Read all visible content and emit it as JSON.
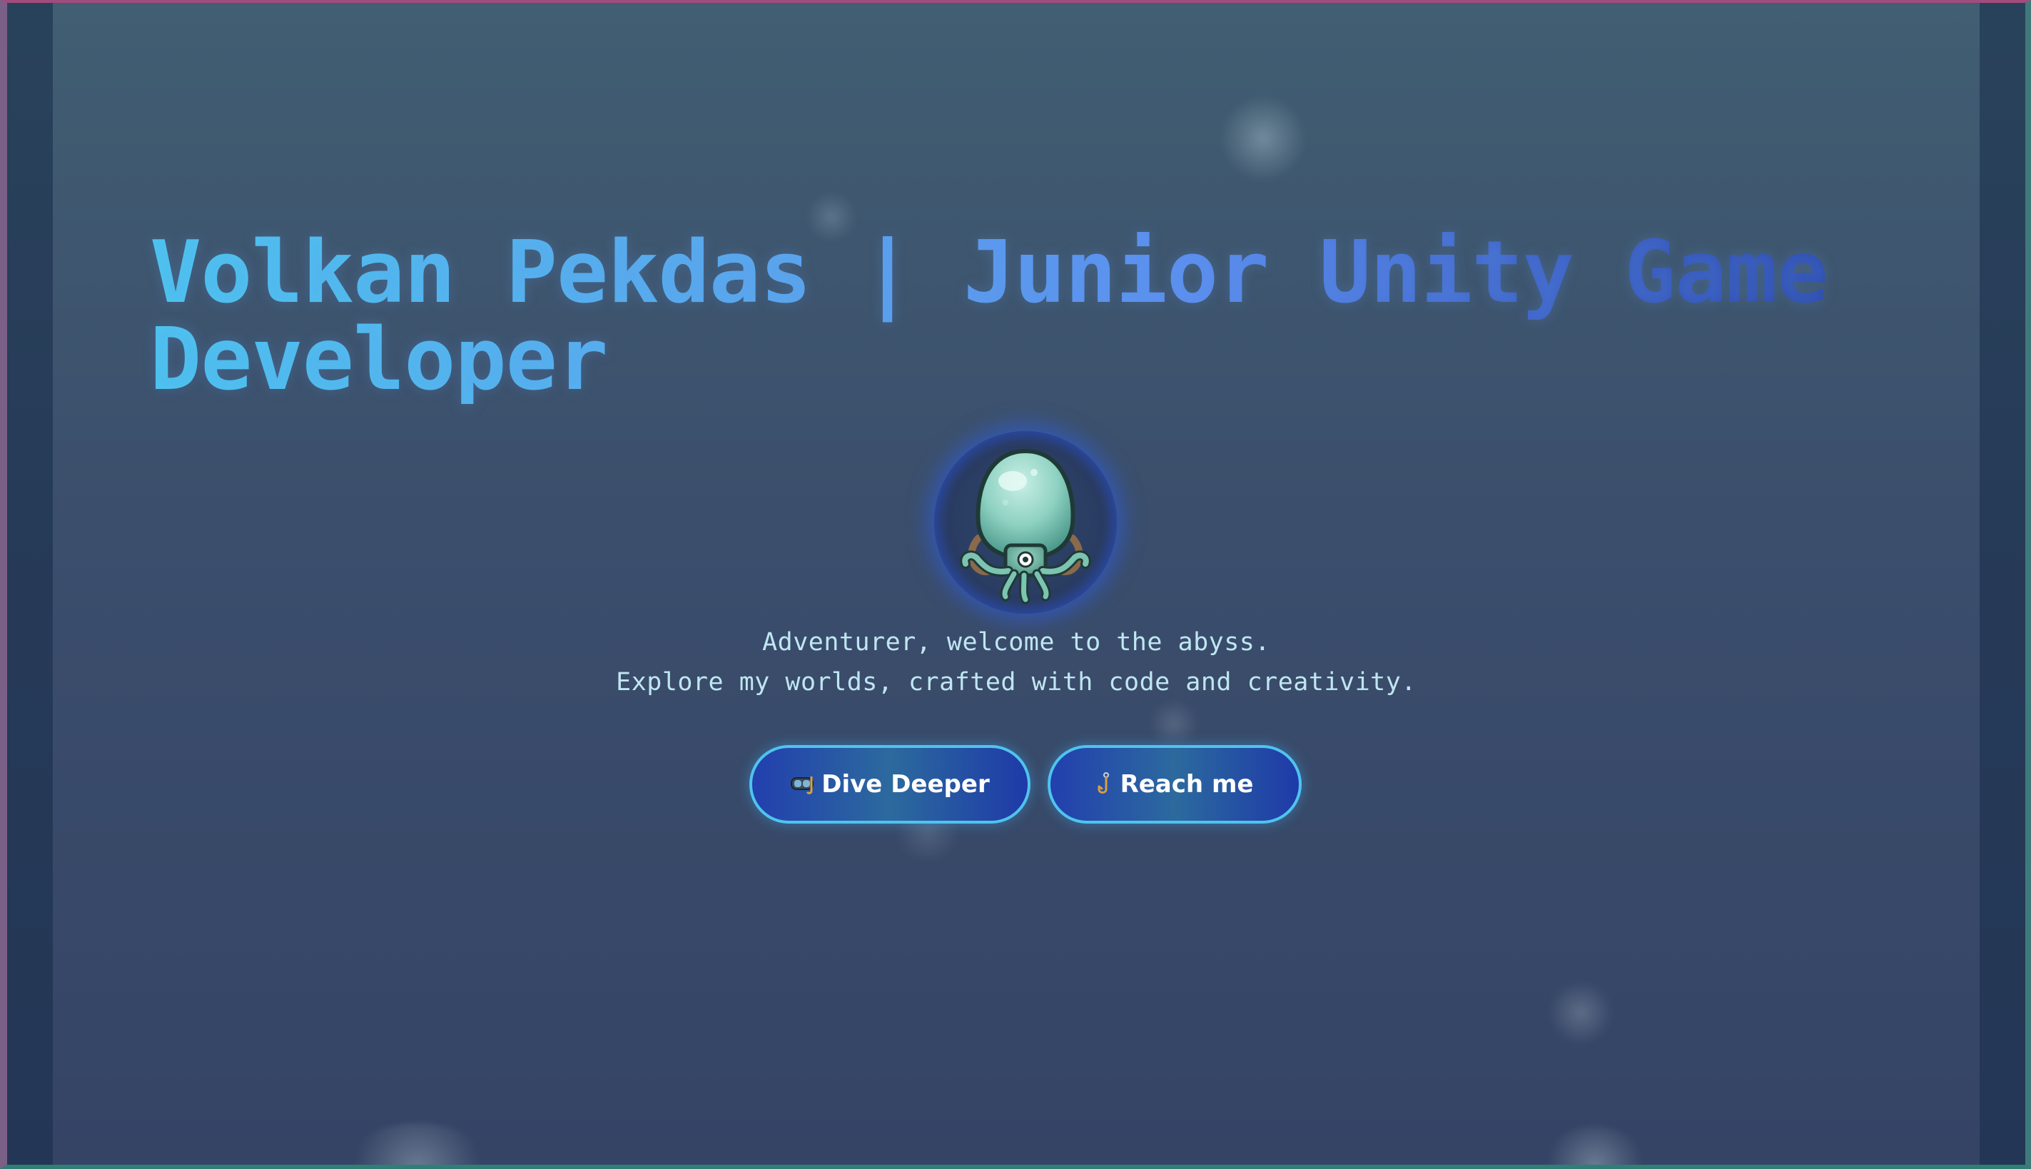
{
  "hero": {
    "title": "Volkan Pekdas | Junior Unity Game Developer",
    "avatar_icon": "octopus-squid-icon",
    "tagline_line1": "Adventurer, welcome to the abyss.",
    "tagline_line2": "Explore my worlds, crafted with code and creativity."
  },
  "actions": {
    "dive_label": "Dive Deeper",
    "dive_icon": "diving-mask-icon",
    "reach_label": "Reach me",
    "reach_icon": "fishing-hook-icon"
  },
  "colors": {
    "title_gradient_start": "#4cc8f0",
    "title_gradient_end": "#2a46a8",
    "button_border": "#4fc3ef",
    "tagline": "#bfe6f2"
  }
}
